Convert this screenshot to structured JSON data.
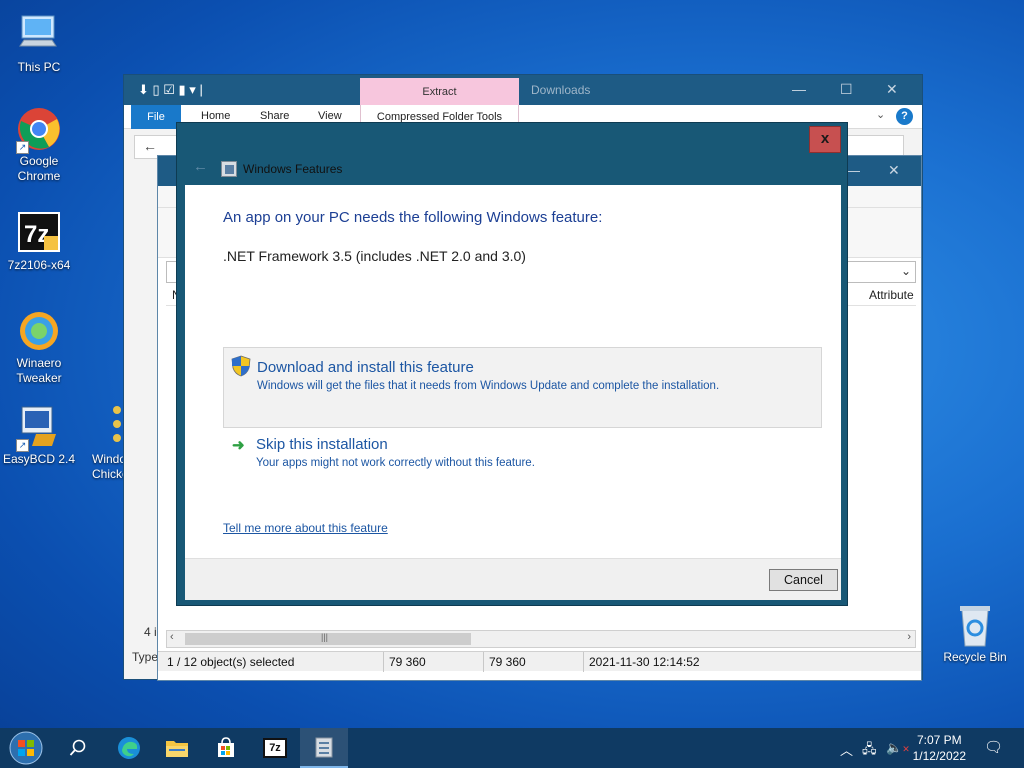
{
  "colors": {
    "desktop_bg": "#1a6fd0",
    "titlebar": "#1e5b85",
    "dialog_frame": "#185876",
    "close_red": "#c75050",
    "link_blue": "#1c56a3",
    "heading_blue": "#1c3f94",
    "extract_pink": "#f7c6dd",
    "taskbar": "#0f3a63"
  },
  "desktop_icons": [
    {
      "label": "This PC",
      "icon": "computer-icon"
    },
    {
      "label": "Google Chrome",
      "icon": "chrome-icon"
    },
    {
      "label": "7z2106-x64",
      "icon": "7zip-installer-icon"
    },
    {
      "label": "Winaero Tweaker",
      "icon": "winaero-icon"
    },
    {
      "label": "EasyBCD 2.4",
      "icon": "easybcd-icon"
    },
    {
      "label": "Windo Chicker",
      "icon": "chicken-icon"
    },
    {
      "label": "Recycle Bin",
      "icon": "recycle-bin-icon"
    }
  ],
  "explorer": {
    "tabs": {
      "file": "File",
      "home": "Home",
      "share": "Share",
      "view": "View"
    },
    "contextual": {
      "extract": "Extract",
      "tools": "Compressed Folder Tools"
    },
    "title": "Downloads",
    "left_peek": {
      "count": "4 i",
      "type": "Type"
    }
  },
  "archive": {
    "column_header": "Attribute",
    "row_fragment_n": "N",
    "status": {
      "selection": "1 / 12 object(s) selected",
      "size": "79 360",
      "packed": "79 360",
      "modified": "2021-11-30 12:14:52"
    },
    "scroll_grip": "|||"
  },
  "dialog": {
    "title": "Windows Features",
    "heading": "An app on your PC needs the following Windows feature:",
    "feature_name": ".NET Framework 3.5 (includes .NET 2.0 and 3.0)",
    "option_download": {
      "title": "Download and install this feature",
      "subtitle": "Windows will get the files that it needs from Windows Update and complete the installation."
    },
    "option_skip": {
      "title": "Skip this installation",
      "subtitle": "Your apps might not work correctly without this feature."
    },
    "more_link": "Tell me more about this feature",
    "cancel": "Cancel",
    "close_glyph": "x"
  },
  "taskbar": {
    "time": "7:07 PM",
    "date": "1/12/2022",
    "apps": [
      "start",
      "search",
      "edge",
      "file-explorer",
      "store",
      "7zip",
      "windows-features"
    ],
    "seven_zip_label": "7z"
  }
}
